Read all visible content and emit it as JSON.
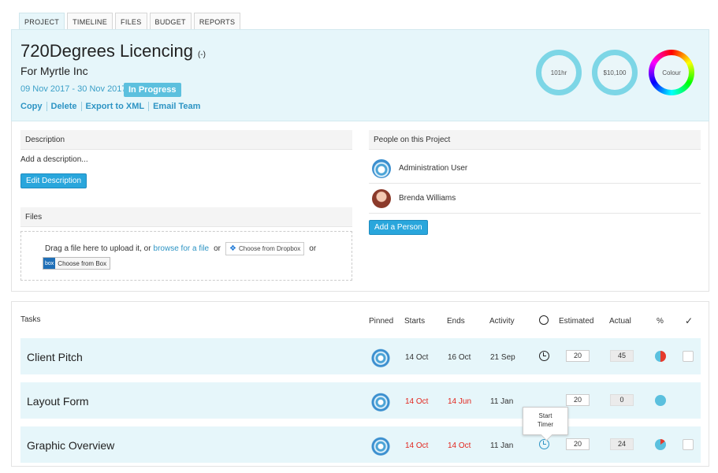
{
  "tabs": [
    "PROJECT",
    "TIMELINE",
    "FILES",
    "BUDGET",
    "REPORTS"
  ],
  "project": {
    "title": "720Degrees Licencing",
    "title_suffix": "(-)",
    "client": "For Myrtle Inc",
    "dates": "09 Nov 2017 - 30 Nov 2017:",
    "status": "In Progress",
    "actions": [
      "Copy",
      "Delete",
      "Export to XML",
      "Email Team"
    ]
  },
  "summary": {
    "hours": "101hr",
    "budget": "$10,100",
    "colour_label": "Colour"
  },
  "description": {
    "heading": "Description",
    "placeholder": "Add a description...",
    "edit_button": "Edit Description"
  },
  "files": {
    "heading": "Files",
    "drag_text": "Drag a file here to upload it, or",
    "browse_link": "browse for a file",
    "or": "or",
    "dropbox_button": "Choose from Dropbox",
    "box_logo": "box",
    "box_button": "Choose from Box"
  },
  "people": {
    "heading": "People on this Project",
    "members": [
      "Administration User",
      "Brenda Williams"
    ],
    "add_button": "Add a Person"
  },
  "tasks": {
    "heading": "Tasks",
    "columns": {
      "pinned": "Pinned",
      "starts": "Starts",
      "ends": "Ends",
      "activity": "Activity",
      "estimated": "Estimated",
      "actual": "Actual",
      "percent": "%",
      "done": "✓"
    },
    "rows": [
      {
        "name": "Client Pitch",
        "starts": "14 Oct",
        "ends": "16 Oct",
        "activity": "21 Sep",
        "estimated": "20",
        "actual": "45"
      },
      {
        "name": "Layout Form",
        "starts": "14 Oct",
        "ends": "14 Jun",
        "activity": "11 Jan",
        "estimated": "20",
        "actual": "0"
      },
      {
        "name": "Graphic Overview",
        "starts": "14 Oct",
        "ends": "14 Oct",
        "activity": "11 Jan",
        "estimated": "20",
        "actual": "24"
      }
    ],
    "tooltip_line1": "Start",
    "tooltip_line2": "Timer"
  },
  "colors": {
    "accent": "#29a6dc",
    "header_bg": "#e6f6fa",
    "overdue": "#e2261e"
  }
}
